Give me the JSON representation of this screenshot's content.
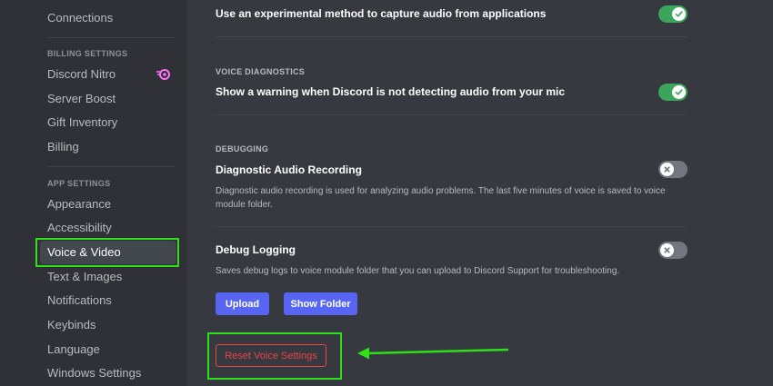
{
  "sidebar": {
    "items_top": [
      {
        "label": "Connections"
      }
    ],
    "billing_header": "BILLING SETTINGS",
    "billing_items": [
      {
        "label": "Discord Nitro"
      },
      {
        "label": "Server Boost"
      },
      {
        "label": "Gift Inventory"
      },
      {
        "label": "Billing"
      }
    ],
    "app_header": "APP SETTINGS",
    "app_items": [
      {
        "label": "Appearance"
      },
      {
        "label": "Accessibility"
      },
      {
        "label": "Voice & Video",
        "selected": true
      },
      {
        "label": "Text & Images"
      },
      {
        "label": "Notifications"
      },
      {
        "label": "Keybinds"
      },
      {
        "label": "Language"
      },
      {
        "label": "Windows Settings"
      }
    ]
  },
  "main": {
    "experimental": {
      "title": "Use an experimental method to capture audio from applications",
      "enabled": true
    },
    "diagnostics": {
      "header": "VOICE DIAGNOSTICS",
      "title": "Show a warning when Discord is not detecting audio from your mic",
      "enabled": true
    },
    "debugging": {
      "header": "DEBUGGING",
      "audio_recording": {
        "title": "Diagnostic Audio Recording",
        "description": "Diagnostic audio recording is used for analyzing audio problems. The last five minutes of voice is saved to voice module folder.",
        "enabled": false
      },
      "debug_logging": {
        "title": "Debug Logging",
        "description": "Saves debug logs to voice module folder that you can upload to Discord Support for troubleshooting.",
        "enabled": false
      },
      "upload_label": "Upload",
      "show_folder_label": "Show Folder"
    },
    "reset_label": "Reset Voice Settings"
  },
  "colors": {
    "accent": "#5865f2",
    "toggle_on": "#3ba55c",
    "toggle_off": "#72767d",
    "danger": "#ed4245",
    "highlight": "#2fe019"
  },
  "icons": {
    "toggle_on": "check-icon",
    "toggle_off": "x-icon",
    "nitro": "nitro-icon",
    "annotation": "arrow-left-icon"
  }
}
